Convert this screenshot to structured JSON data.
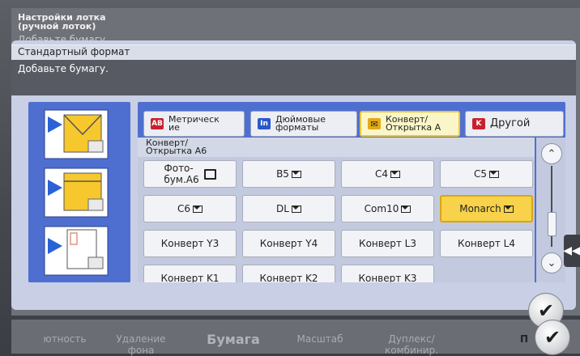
{
  "background": {
    "title": "Настройки лотка\n(ручной лоток)",
    "subtitle": "Добавьте бумагу.",
    "bottom_tabs": [
      "ютность",
      "Удаление\nфона",
      "Бумага",
      "Масштаб",
      "Дуплекс/\nкомбинир.",
      "П"
    ]
  },
  "dialog": {
    "title": "Стандартный формат",
    "message": "Добавьте бумагу."
  },
  "tabs": [
    {
      "icon": "AB",
      "label": "Метрическ\nие"
    },
    {
      "icon": "In",
      "label": "Дюймовые\nформаты"
    },
    {
      "icon": "✉",
      "label": "Конверт/\nОткрытка А"
    },
    {
      "icon": "K",
      "label": "Другой"
    }
  ],
  "list": {
    "header": "Конверт/\nОткрытка А6",
    "items": [
      {
        "label": "Фото-\nбум.А6",
        "icon": "photo-icon"
      },
      {
        "label": "B5",
        "icon": "envelope-icon"
      },
      {
        "label": "C4",
        "icon": "envelope-icon"
      },
      {
        "label": "C5",
        "icon": "envelope-icon"
      },
      {
        "label": "C6",
        "icon": "envelope-icon"
      },
      {
        "label": "DL",
        "icon": "envelope-icon"
      },
      {
        "label": "Com10",
        "icon": "envelope-icon"
      },
      {
        "label": "Monarch",
        "icon": "envelope-icon",
        "selected": true
      },
      {
        "label": "Конверт Y3"
      },
      {
        "label": "Конверт Y4"
      },
      {
        "label": "Конверт L3"
      },
      {
        "label": "Конверт L4"
      },
      {
        "label": "Конверт K1"
      },
      {
        "label": "Конверт K2"
      },
      {
        "label": "Конверт K3"
      }
    ]
  },
  "colors": {
    "accent": "#f7d24a",
    "panel": "#4f6fd0"
  }
}
